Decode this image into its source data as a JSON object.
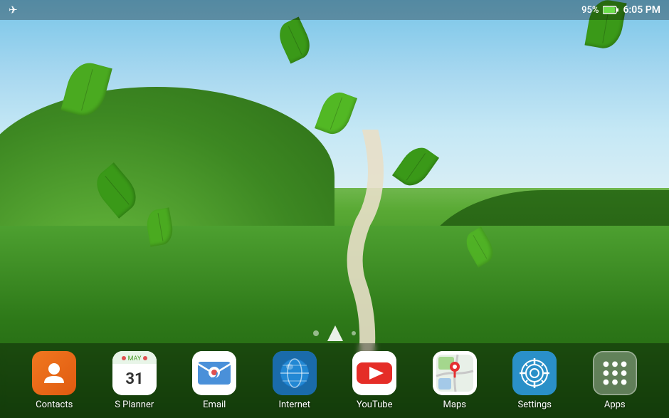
{
  "status_bar": {
    "left_icon": "✈",
    "battery_percent": "95%",
    "time": "6:05 PM"
  },
  "home_indicator": {
    "dots": [
      1,
      2,
      3
    ],
    "active_dot": 1
  },
  "dock": {
    "apps": [
      {
        "id": "contacts",
        "label": "Contacts",
        "icon_type": "contacts"
      },
      {
        "id": "splanner",
        "label": "S Planner",
        "icon_type": "splanner"
      },
      {
        "id": "email",
        "label": "Email",
        "icon_type": "email"
      },
      {
        "id": "internet",
        "label": "Internet",
        "icon_type": "internet"
      },
      {
        "id": "youtube",
        "label": "YouTube",
        "icon_type": "youtube"
      },
      {
        "id": "maps",
        "label": "Maps",
        "icon_type": "maps"
      },
      {
        "id": "settings",
        "label": "Settings",
        "icon_type": "settings"
      },
      {
        "id": "apps",
        "label": "Apps",
        "icon_type": "apps"
      }
    ]
  }
}
